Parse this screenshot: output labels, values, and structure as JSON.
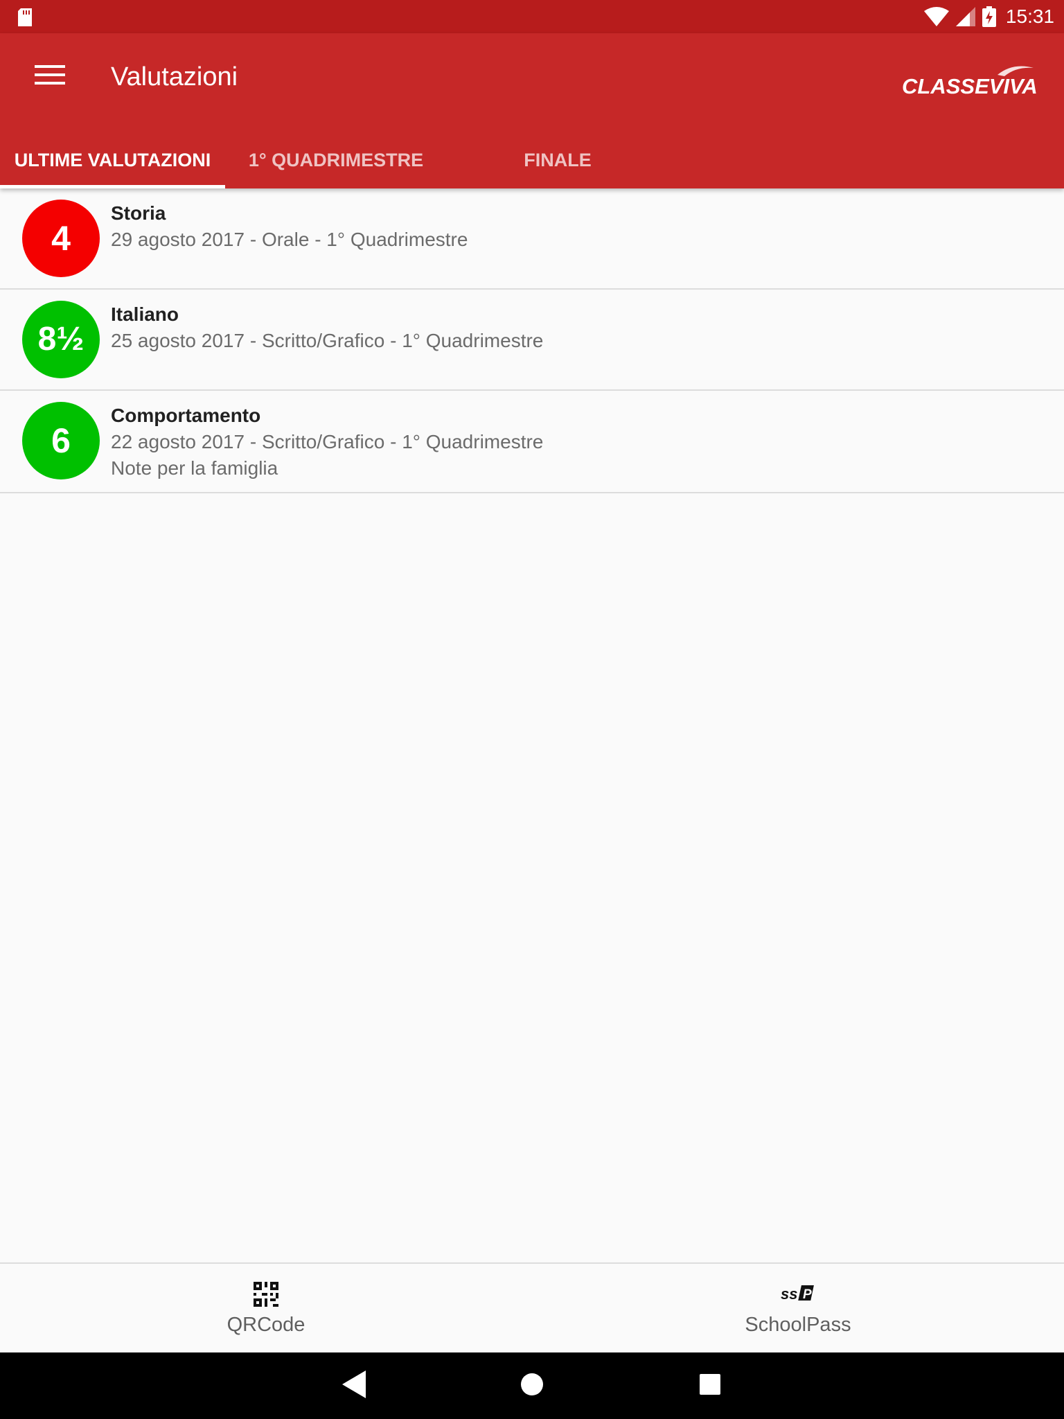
{
  "status_bar": {
    "time": "15:31"
  },
  "app_bar": {
    "title": "Valutazioni",
    "logo_text": "CLASSEVIVA"
  },
  "tabs": [
    {
      "label": "ULTIME VALUTAZIONI",
      "active": true
    },
    {
      "label": "1° QUADRIMESTRE",
      "active": false
    },
    {
      "label": "FINALE",
      "active": false
    }
  ],
  "grades": [
    {
      "value": "4",
      "color": "#f40000",
      "subject": "Storia",
      "detail": "29 agosto 2017 - Orale - 1° Quadrimestre",
      "note": ""
    },
    {
      "value": "8½",
      "color": "#00c000",
      "subject": "Italiano",
      "detail": "25 agosto 2017 - Scritto/Grafico - 1° Quadrimestre",
      "note": ""
    },
    {
      "value": "6",
      "color": "#00c000",
      "subject": "Comportamento",
      "detail": "22 agosto 2017 - Scritto/Grafico - 1° Quadrimestre",
      "note": "Note per la famiglia"
    }
  ],
  "bottom_nav": [
    {
      "label": "QRCode",
      "icon": "qrcode-icon"
    },
    {
      "label": "SchoolPass",
      "icon": "schoolpass-icon",
      "icon_text": "SSP"
    }
  ],
  "colors": {
    "status_bar": "#b71c1c",
    "app_bar": "#c62828",
    "grade_fail": "#f40000",
    "grade_pass": "#00c000"
  }
}
